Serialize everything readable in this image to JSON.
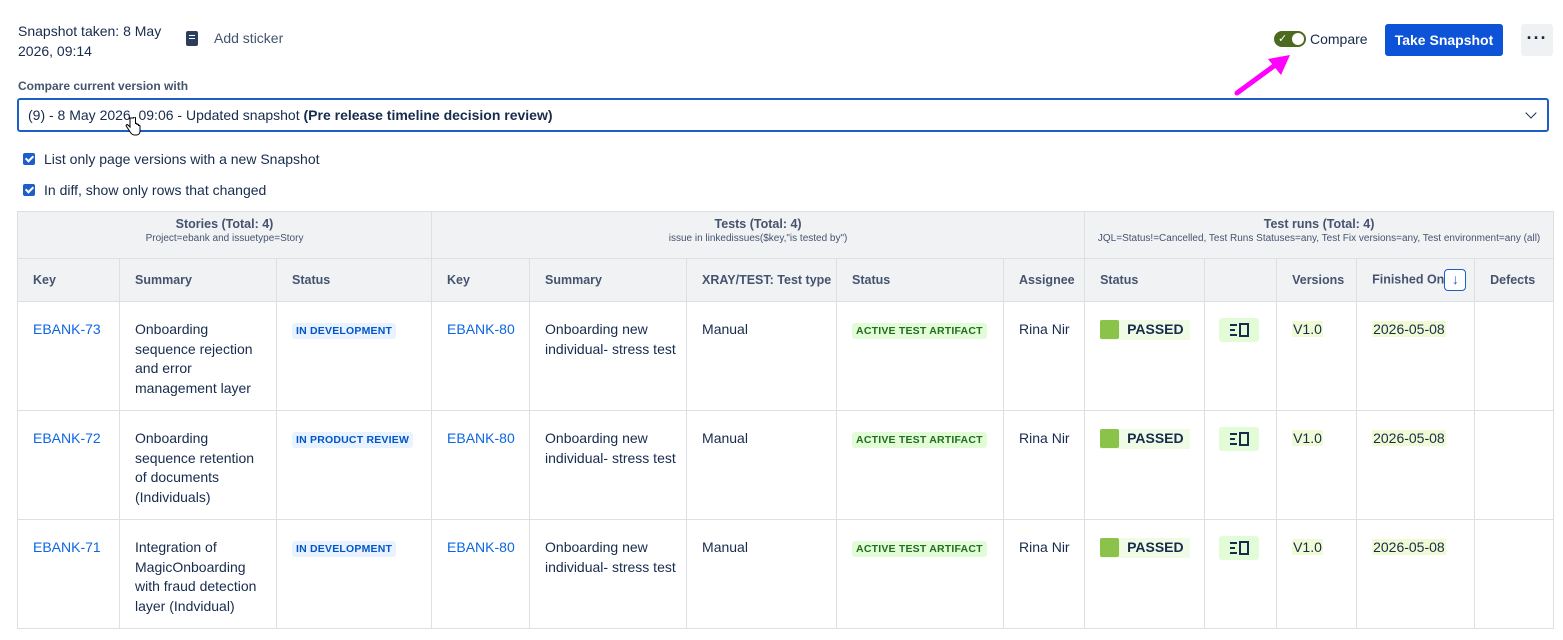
{
  "header": {
    "snapshot_label": "Snapshot taken: 8 May 2026, 09:14",
    "add_sticker": "Add sticker",
    "compare_label": "Compare",
    "compare_on": true,
    "take_snapshot": "Take Snapshot",
    "more": "···"
  },
  "compare": {
    "label": "Compare current version with",
    "selected_prefix": "(9) - 8 May 2026, 09:06 - Updated snapshot ",
    "selected_bold": "(Pre release timeline decision review)"
  },
  "options": {
    "list_only": "List only page versions with a new Snapshot",
    "diff_only": "In diff, show only rows that changed"
  },
  "table": {
    "groups": [
      {
        "title": "Stories (Total: 4)",
        "sub": "Project=ebank and issuetype=Story"
      },
      {
        "title": "Tests (Total: 4)",
        "sub": "issue in linkedissues($key,\"is tested by\")"
      },
      {
        "title": "Test runs (Total: 4)",
        "sub": "JQL=Status!=Cancelled, Test Runs Statuses=any, Test Fix versions=any, Test environment=any (all)"
      }
    ],
    "columns": [
      "Key",
      "Summary",
      "Status",
      "Key",
      "Summary",
      "XRAY/TEST: Test type",
      "Status",
      "Assignee",
      "Status",
      "",
      "Versions",
      "Finished On",
      "Defects"
    ],
    "rows": [
      {
        "story_key": "EBANK-73",
        "story_summary": "Onboarding sequence rejection and error management layer",
        "story_status": "IN DEVELOPMENT",
        "test_key": "EBANK-80",
        "test_summary": "Onboarding new individual- stress test",
        "test_type": "Manual",
        "test_status": "ACTIVE TEST ARTIFACT",
        "assignee": "Rina Nir",
        "run_status": "PASSED",
        "version": "V1.0",
        "finished": "2026-05-08",
        "defects": ""
      },
      {
        "story_key": "EBANK-72",
        "story_summary": "Onboarding sequence retention of documents (Individuals)",
        "story_status": "IN PRODUCT REVIEW",
        "test_key": "EBANK-80",
        "test_summary": "Onboarding new individual- stress test",
        "test_type": "Manual",
        "test_status": "ACTIVE TEST ARTIFACT",
        "assignee": "Rina Nir",
        "run_status": "PASSED",
        "version": "V1.0",
        "finished": "2026-05-08",
        "defects": ""
      },
      {
        "story_key": "EBANK-71",
        "story_summary": "Integration of MagicOnboarding with fraud detection layer (Indvidual)",
        "story_status": "IN DEVELOPMENT",
        "test_key": "EBANK-80",
        "test_summary": "Onboarding new individual- stress test",
        "test_type": "Manual",
        "test_status": "ACTIVE TEST ARTIFACT",
        "assignee": "Rina Nir",
        "run_status": "PASSED",
        "version": "V1.0",
        "finished": "2026-05-08",
        "defects": ""
      }
    ]
  },
  "colors": {
    "primary": "#0c53d8",
    "toggle": "#4c6b1f",
    "annotation_arrow": "#ff00ff",
    "passed": "#8bc34a"
  }
}
